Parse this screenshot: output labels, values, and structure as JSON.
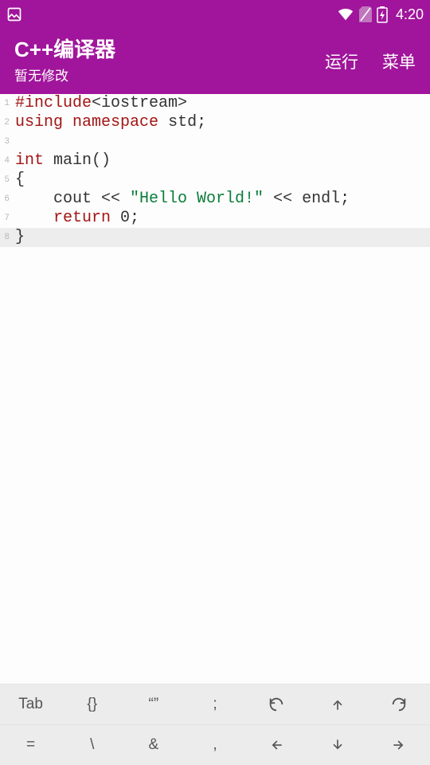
{
  "status": {
    "time": "4:20"
  },
  "appbar": {
    "title": "C++编译器",
    "subtitle": "暂无修改",
    "run": "运行",
    "menu": "菜单"
  },
  "code": {
    "lines": [
      {
        "n": "1",
        "hl": false,
        "segs": [
          {
            "c": "tok-macro",
            "t": "#include"
          },
          {
            "c": "tok-include-target",
            "t": "<iostream>"
          }
        ]
      },
      {
        "n": "2",
        "hl": false,
        "segs": [
          {
            "c": "tok-keyword",
            "t": "using"
          },
          {
            "c": "tok-plain",
            "t": " "
          },
          {
            "c": "tok-keyword",
            "t": "namespace"
          },
          {
            "c": "tok-plain",
            "t": " std;"
          }
        ]
      },
      {
        "n": "3",
        "hl": false,
        "segs": []
      },
      {
        "n": "4",
        "hl": false,
        "segs": [
          {
            "c": "tok-type",
            "t": "int"
          },
          {
            "c": "tok-plain",
            "t": " main()"
          }
        ]
      },
      {
        "n": "5",
        "hl": false,
        "segs": [
          {
            "c": "tok-plain",
            "t": "{"
          }
        ]
      },
      {
        "n": "6",
        "hl": false,
        "segs": [
          {
            "c": "tok-plain",
            "t": "    cout << "
          },
          {
            "c": "tok-string",
            "t": "\"Hello World!\""
          },
          {
            "c": "tok-plain",
            "t": " << endl;"
          }
        ]
      },
      {
        "n": "7",
        "hl": false,
        "segs": [
          {
            "c": "tok-plain",
            "t": "    "
          },
          {
            "c": "tok-keyword",
            "t": "return"
          },
          {
            "c": "tok-plain",
            "t": " 0;"
          }
        ]
      },
      {
        "n": "8",
        "hl": true,
        "segs": [
          {
            "c": "tok-plain",
            "t": "}"
          }
        ]
      }
    ]
  },
  "keyrow1": {
    "k0": "Tab",
    "k1": "{}",
    "k2": "“”",
    "k3": ";"
  },
  "keyrow2": {
    "k0": "=",
    "k1": "\\",
    "k2": "&",
    "k3": ","
  }
}
